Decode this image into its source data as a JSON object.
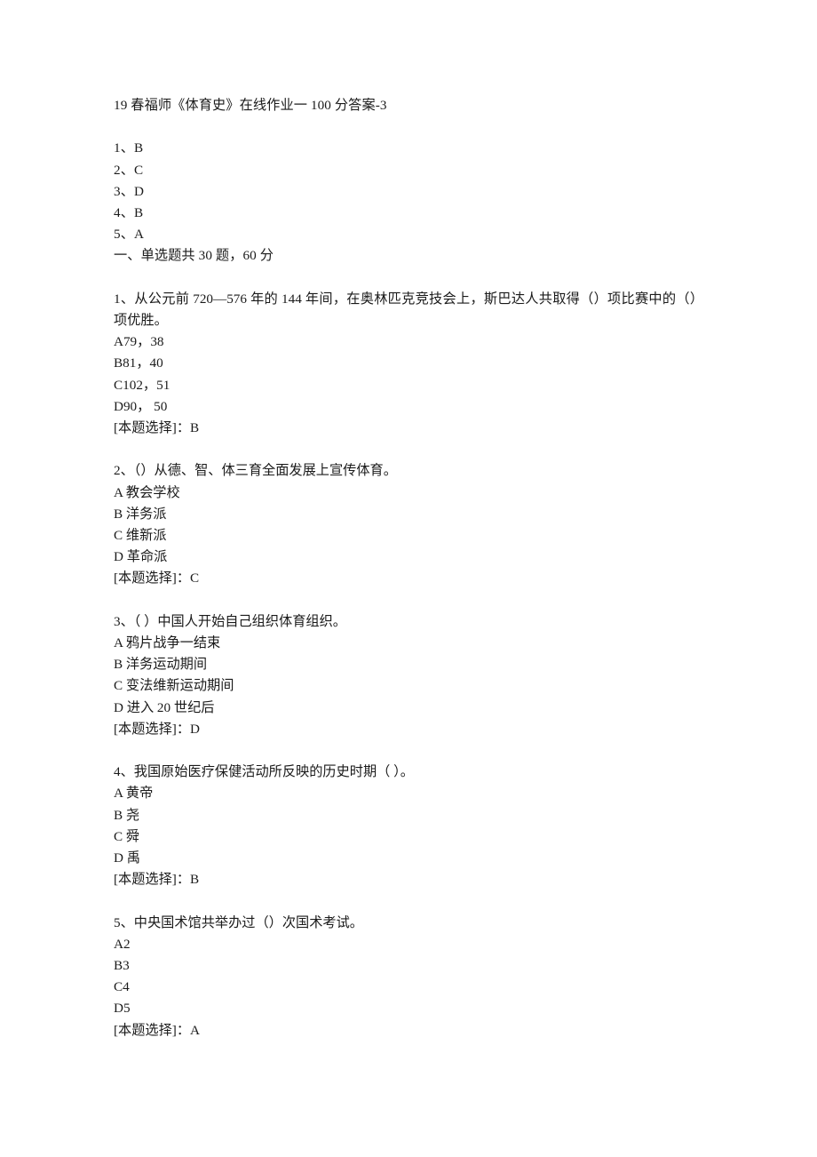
{
  "document": {
    "title": "19 春福师《体育史》在线作业一 100 分答案-3",
    "answer_key": [
      "1、B",
      "2、C",
      "3、D",
      "4、B",
      "5、A"
    ],
    "section_heading": "一、单选题共 30 题，60 分",
    "answer_label_prefix": "[本题选择]：",
    "questions": [
      {
        "stem": "1、从公元前 720—576 年的 144 年间，在奥林匹克竞技会上，斯巴达人共取得（）项比赛中的（）项优胜。",
        "options": [
          "A79，38",
          "B81，40",
          "C102，51",
          "D90， 50"
        ],
        "answer": "B",
        "answer_line": "[本题选择]：B"
      },
      {
        "stem": "2、（）从德、智、体三育全面发展上宣传体育。",
        "options": [
          "A 教会学校",
          "B 洋务派",
          "C 维新派",
          "D 革命派"
        ],
        "answer": "C",
        "answer_line": "[本题选择]：C"
      },
      {
        "stem": "3、（ ）中国人开始自己组织体育组织。",
        "options": [
          "A 鸦片战争一结束",
          "B 洋务运动期间",
          "C 变法维新运动期间",
          "D 进入 20 世纪后"
        ],
        "answer": "D",
        "answer_line": "[本题选择]：D"
      },
      {
        "stem": "4、我国原始医疗保健活动所反映的历史时期（ ）。",
        "options": [
          "A 黄帝",
          "B 尧",
          "C 舜",
          "D 禹"
        ],
        "answer": "B",
        "answer_line": "[本题选择]：B"
      },
      {
        "stem": "5、中央国术馆共举办过（）次国术考试。",
        "options": [
          "A2",
          "B3",
          "C4",
          "D5"
        ],
        "answer": "A",
        "answer_line": "[本题选择]：A"
      }
    ]
  },
  "style": {
    "background_color": "#ffffff",
    "text_color": "#1a1a1a"
  }
}
